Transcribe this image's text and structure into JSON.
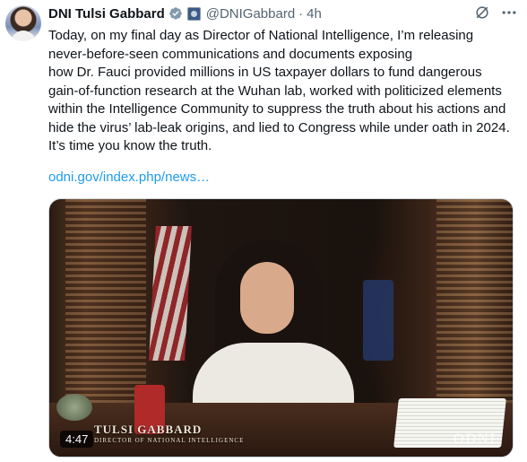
{
  "tweet": {
    "author_name": "DNI Tulsi Gabbard",
    "handle": "@DNIGabbard",
    "separator": "·",
    "time": "4h",
    "text_lines": [
      "Today, on my final day as Director of National Intelligence, I’m releasing",
      "never-before-seen communications and documents exposing",
      "how Dr. Fauci provided millions in US taxpayer dollars to fund dangerous",
      "gain-of-function research at the Wuhan lab, worked with politicized elements",
      "within the Intelligence Community to suppress the truth about his actions and",
      "hide the virus’ lab-leak origins, and lied to Congress while under oath in 2024.",
      "It’s time you know the truth."
    ],
    "link": "odni.gov/index.php/news…"
  },
  "icons": {
    "verified": "verified-badge-icon",
    "org": "affiliate-badge-icon",
    "grok": "grok-icon",
    "more": "more-options-icon"
  },
  "video": {
    "duration": "4:47",
    "lower_third_name": "TULSI GABBARD",
    "lower_third_title": "DIRECTOR OF NATIONAL INTELLIGENCE",
    "watermark": "ODNI"
  },
  "colors": {
    "text": "#0f1419",
    "secondary": "#536471",
    "link": "#1d9bf0",
    "verified": "#829aab"
  }
}
